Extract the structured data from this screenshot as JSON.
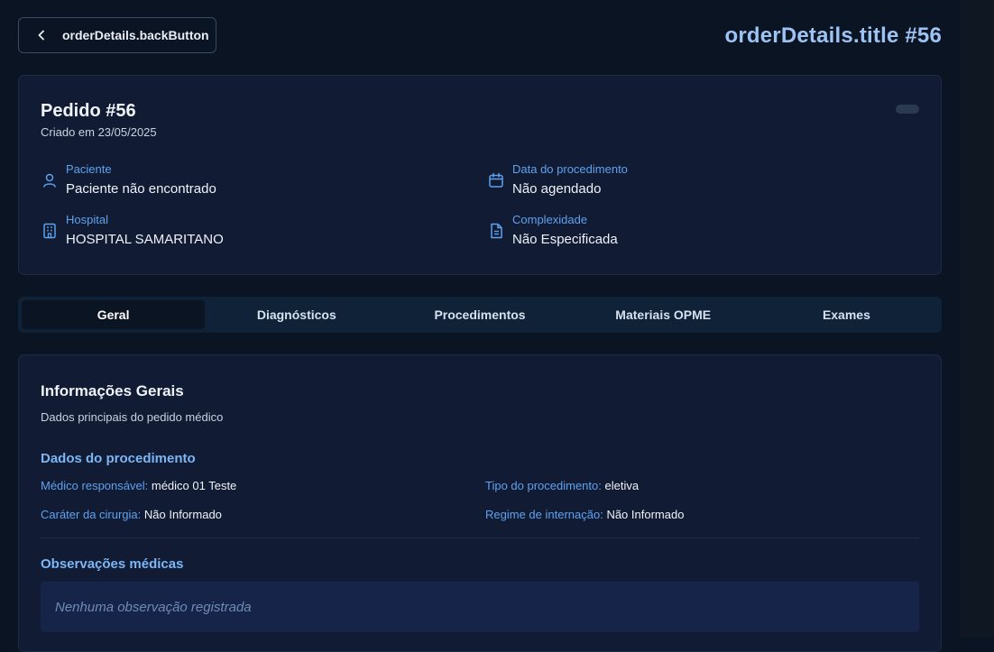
{
  "header": {
    "back_label": "orderDetails.backButton",
    "title": "orderDetails.title #56"
  },
  "order": {
    "name": "Pedido #56",
    "created": "Criado em 23/05/2025"
  },
  "info": {
    "patient_label": "Paciente",
    "patient_value": "Paciente não encontrado",
    "date_label": "Data do procedimento",
    "date_value": "Não agendado",
    "hospital_label": "Hospital",
    "hospital_value": "HOSPITAL SAMARITANO",
    "complexity_label": "Complexidade",
    "complexity_value": "Não Especificada"
  },
  "tabs": [
    {
      "label": "Geral"
    },
    {
      "label": "Diagnósticos"
    },
    {
      "label": "Procedimentos"
    },
    {
      "label": "Materiais OPME"
    },
    {
      "label": "Exames"
    }
  ],
  "general": {
    "title": "Informações Gerais",
    "subtitle": "Dados principais do pedido médico",
    "procedure_heading": "Dados do procedimento",
    "doctor_label": "Médico responsável:",
    "doctor_value": "médico 01 Teste",
    "type_label": "Tipo do procedimento:",
    "type_value": "eletiva",
    "character_label": "Caráter da cirurgia:",
    "character_value": "Não Informado",
    "regime_label": "Regime de internação:",
    "regime_value": "Não Informado",
    "observations_heading": "Observações médicas",
    "observations_empty": "Nenhuma observação registrada"
  },
  "colors": {
    "background": "#0b1423",
    "card": "#111b33",
    "accent": "#5fa2ee",
    "title": "#9cc3f2"
  }
}
